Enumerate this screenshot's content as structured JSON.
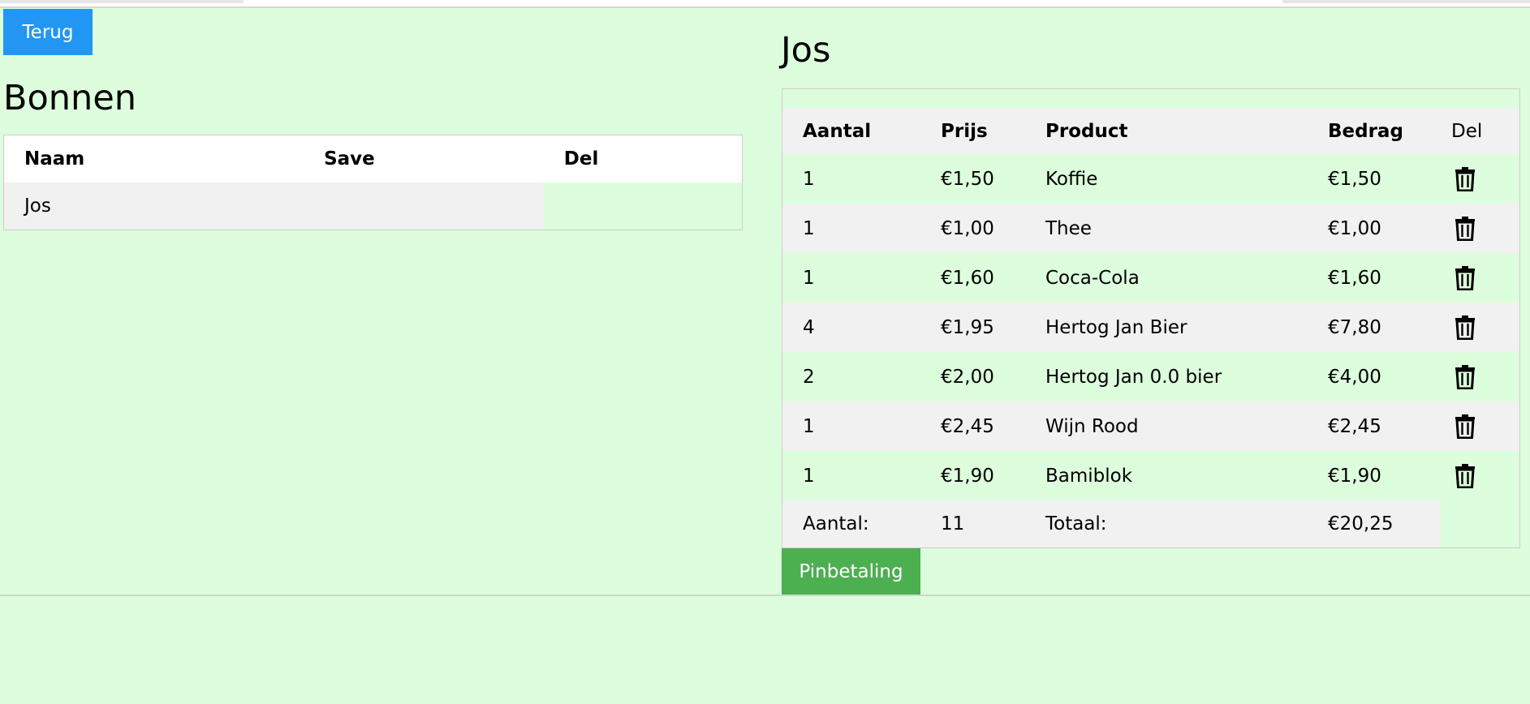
{
  "back_button": "Terug",
  "bonnen": {
    "title": "Bonnen",
    "columns": [
      "Naam",
      "Save",
      "Del"
    ],
    "rows": [
      {
        "naam": "Jos"
      }
    ]
  },
  "receipt": {
    "title": "Jos",
    "columns": [
      "Aantal",
      "Prijs",
      "Product",
      "Bedrag",
      "Del"
    ],
    "rows": [
      {
        "aantal": "1",
        "prijs": "€1,50",
        "product": "Koffie",
        "bedrag": "€1,50"
      },
      {
        "aantal": "1",
        "prijs": "€1,00",
        "product": "Thee",
        "bedrag": "€1,00"
      },
      {
        "aantal": "1",
        "prijs": "€1,60",
        "product": "Coca-Cola",
        "bedrag": "€1,60"
      },
      {
        "aantal": "4",
        "prijs": "€1,95",
        "product": "Hertog Jan Bier",
        "bedrag": "€7,80"
      },
      {
        "aantal": "2",
        "prijs": "€2,00",
        "product": "Hertog Jan 0.0 bier",
        "bedrag": "€4,00"
      },
      {
        "aantal": "1",
        "prijs": "€2,45",
        "product": "Wijn Rood",
        "bedrag": "€2,45"
      },
      {
        "aantal": "1",
        "prijs": "€1,90",
        "product": "Bamiblok",
        "bedrag": "€1,90"
      }
    ],
    "totals": {
      "aantal_label": "Aantal:",
      "aantal_value": "11",
      "totaal_label": "Totaal:",
      "totaal_value": "€20,25"
    },
    "row_icon": "trash-icon"
  },
  "pay_button": "Pinbetaling",
  "colors": {
    "background": "#ddfedd",
    "back_button": "#2196f3",
    "pay_button": "#4caf50",
    "row_alt": "#f1f1f1"
  }
}
